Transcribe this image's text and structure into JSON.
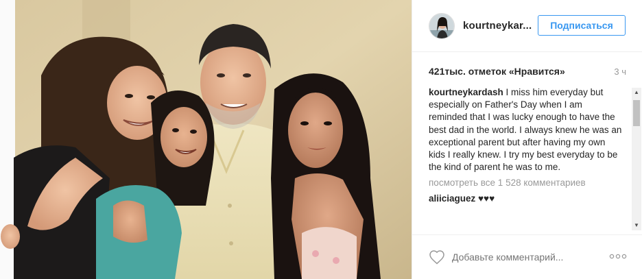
{
  "post": {
    "username": "kourtneykardash",
    "header_username": "kourtneykar...",
    "follow_label": "Подписаться",
    "likes": "421тыс. отметок «Нравится»",
    "time": "3 ч",
    "caption_user": "kourtneykardash",
    "caption_text": " I miss him everyday but especially on Father's Day when I am reminded that I was lucky enough to have the best dad in the world. I always knew he was an exceptional parent but after having my own kids I really knew. I try my best everyday to be the kind of parent he was to me.",
    "view_all_comments": "посмотреть все 1 528 комментариев",
    "comments": [
      {
        "user": "aliiciaguez",
        "text": " ♥♥♥"
      }
    ],
    "add_comment_placeholder": "Добавьте комментарий..."
  },
  "photo": {
    "description_icon": "family-photo"
  },
  "colors": {
    "accent": "#3897f0",
    "muted": "#999999",
    "border": "#efefef"
  }
}
